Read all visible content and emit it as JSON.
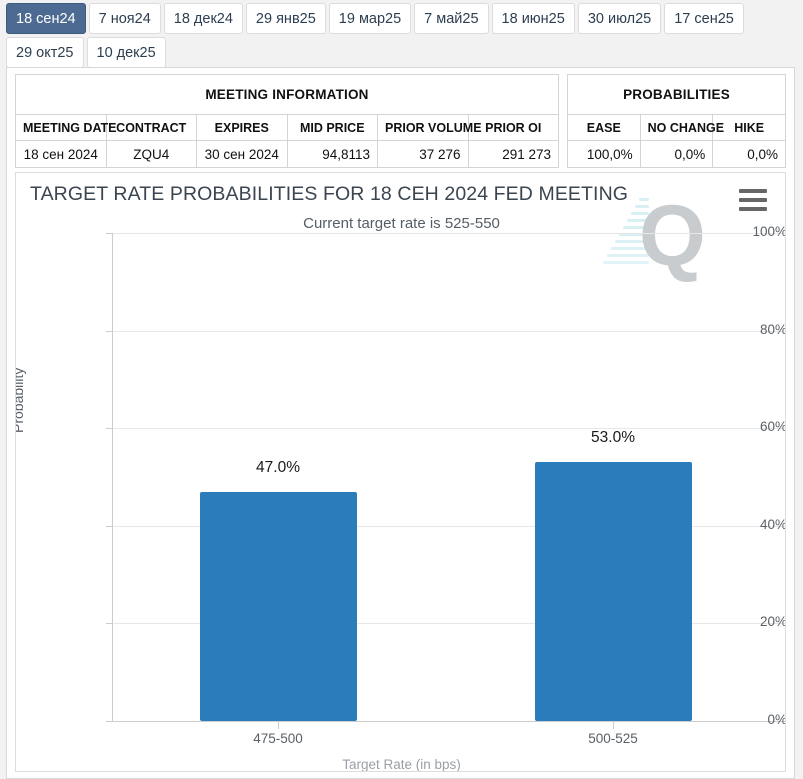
{
  "tabs": {
    "items": [
      {
        "label": "18 сен24",
        "active": true
      },
      {
        "label": "7 ноя24",
        "active": false
      },
      {
        "label": "18 дек24",
        "active": false
      },
      {
        "label": "29 янв25",
        "active": false
      },
      {
        "label": "19 мар25",
        "active": false
      },
      {
        "label": "7 май25",
        "active": false
      },
      {
        "label": "18 июн25",
        "active": false
      },
      {
        "label": "30 июл25",
        "active": false
      },
      {
        "label": "17 сен25",
        "active": false
      },
      {
        "label": "29 окт25",
        "active": false
      },
      {
        "label": "10 дек25",
        "active": false
      }
    ]
  },
  "meeting_information": {
    "group_header": "MEETING INFORMATION",
    "columns": [
      "MEETING DATE",
      "CONTRACT",
      "EXPIRES",
      "MID PRICE",
      "PRIOR VOLUME",
      "PRIOR OI"
    ],
    "row": [
      "18 сен 2024",
      "ZQU4",
      "30 сен 2024",
      "94,8113",
      "37 276",
      "291 273"
    ]
  },
  "probabilities": {
    "group_header": "PROBABILITIES",
    "columns": [
      "EASE",
      "NO CHANGE",
      "HIKE"
    ],
    "row": [
      "100,0%",
      "0,0%",
      "0,0%"
    ]
  },
  "chart_header": {
    "title": "TARGET RATE PROBABILITIES FOR 18 СЕН 2024 FED MEETING",
    "subtitle": "Current target rate is 525-550",
    "menu_icon": "hamburger-menu-icon"
  },
  "watermark": {
    "letter": "Q"
  },
  "chart_data": {
    "type": "bar",
    "title": "TARGET RATE PROBABILITIES FOR 18 СЕН 2024 FED MEETING",
    "subtitle": "Current target rate is 525-550",
    "categories": [
      "475-500",
      "500-525"
    ],
    "values": [
      47.0,
      53.0
    ],
    "data_labels": [
      "47.0%",
      "53.0%"
    ],
    "xlabel": "Target Rate (in bps)",
    "ylabel": "Probability",
    "ylim": [
      0,
      100
    ],
    "yticks": [
      0,
      20,
      40,
      60,
      80,
      100
    ],
    "ytick_labels": [
      "0%",
      "20%",
      "40%",
      "60%",
      "80%",
      "100%"
    ],
    "grid": true,
    "legend": false,
    "bar_color": "#2b7cba"
  },
  "colors": {
    "bar": "#2b7cba",
    "active_tab_bg": "#4d6b92",
    "tab_text": "#2c3e50",
    "title": "#3b4550",
    "subtitle": "#555d66",
    "grid": "#e7e7e7"
  }
}
